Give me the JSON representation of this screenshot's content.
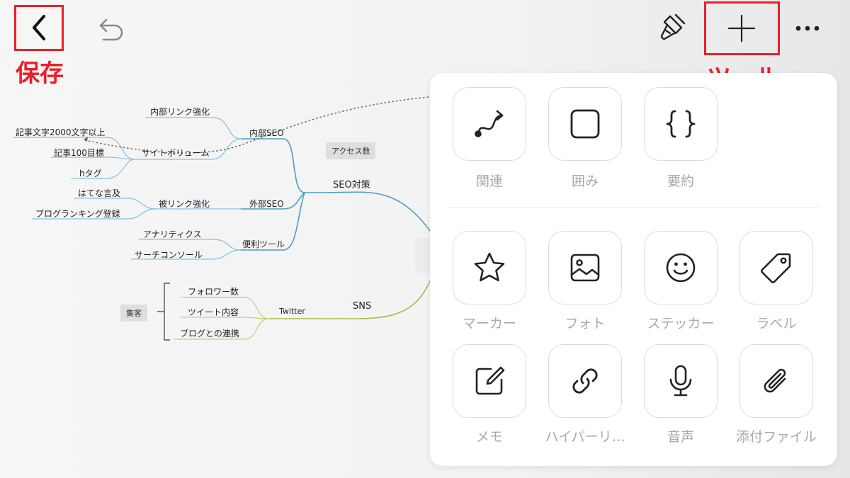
{
  "annotations": {
    "save": "保存",
    "tool": "ツール"
  },
  "mindmap": {
    "central_left": [
      "SEO対策",
      "SNS"
    ],
    "badges": {
      "access": "アクセス数",
      "attract": "集客"
    },
    "labels": {
      "naibu_seo": "内部SEO",
      "naibu_link": "内部リンク強化",
      "site_volume": "サイトボリューム",
      "kiji2000": "記事文字2000文字以上",
      "kiji100": "記事100目標",
      "htag": "hタグ",
      "gaibu_seo": "外部SEO",
      "hisetsu_link": "被リンク強化",
      "hatena": "はてな言及",
      "blog_rank": "ブログランキング登録",
      "benri_tool": "便利ツール",
      "analytics": "アナリティクス",
      "search_console": "サーチコンソール",
      "twitter": "Twitter",
      "follower": "フォロワー数",
      "tweet": "ツイート内容",
      "blog_renkei": "ブログとの連携"
    }
  },
  "panel": {
    "row1": [
      {
        "label": "関連",
        "icon": "relation-curve-icon"
      },
      {
        "label": "囲み",
        "icon": "boundary-square-icon"
      },
      {
        "label": "要約",
        "icon": "summary-braces-icon"
      }
    ],
    "row2": [
      {
        "label": "マーカー",
        "icon": "star-icon"
      },
      {
        "label": "フォト",
        "icon": "image-icon"
      },
      {
        "label": "ステッカー",
        "icon": "smiley-icon"
      },
      {
        "label": "ラベル",
        "icon": "tag-icon"
      }
    ],
    "row3": [
      {
        "label": "メモ",
        "icon": "note-edit-icon"
      },
      {
        "label": "ハイパーリ…",
        "icon": "link-icon"
      },
      {
        "label": "音声",
        "icon": "microphone-icon"
      },
      {
        "label": "添付ファイル",
        "icon": "paperclip-icon"
      }
    ]
  }
}
